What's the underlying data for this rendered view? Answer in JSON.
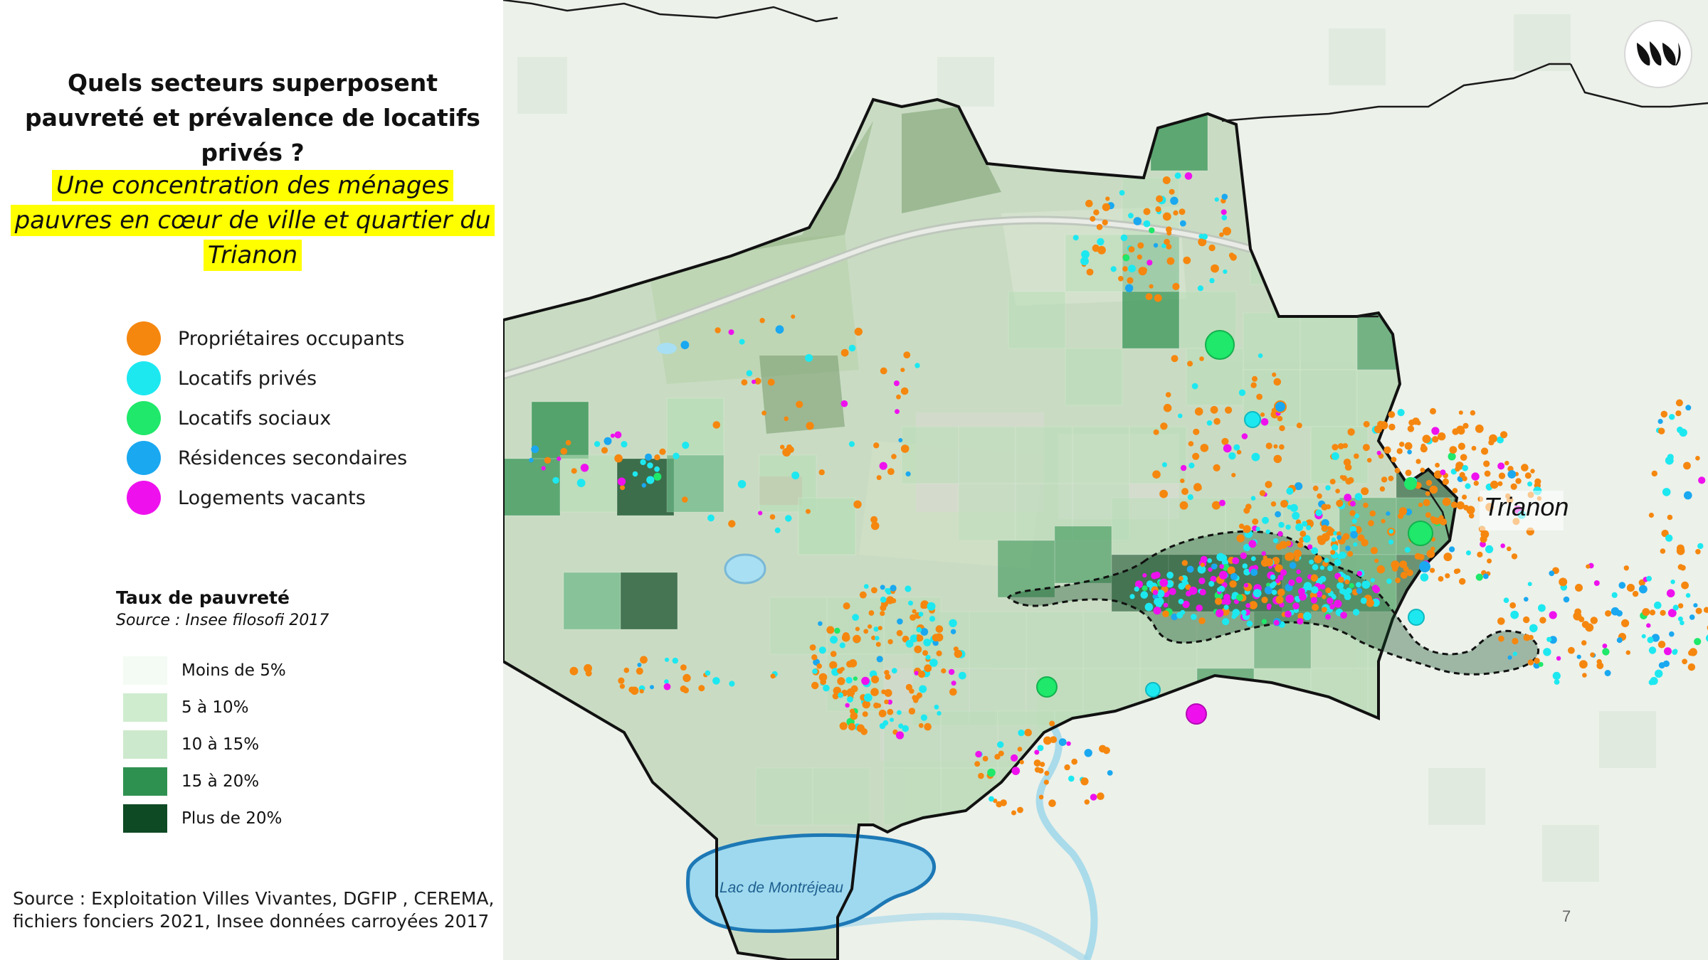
{
  "slide": {
    "title": "Quels secteurs superposent pauvreté et prévalence de locatifs privés ?",
    "subtitle": "Une concentration des ménages pauvres en cœur de ville et quartier du Trianon",
    "page_number": "7"
  },
  "legend": {
    "items": [
      {
        "label": "Propriétaires occupants",
        "color": "#f5870f"
      },
      {
        "label": "Locatifs privés",
        "color": "#1de8f0"
      },
      {
        "label": "Locatifs sociaux",
        "color": "#1fe86a"
      },
      {
        "label": "Résidences secondaires",
        "color": "#1aa8f0"
      },
      {
        "label": "Logements vacants",
        "color": "#ee11ee"
      }
    ]
  },
  "poverty_scale": {
    "title": "Taux de pauvreté",
    "source": "Source : Insee filosofi 2017",
    "classes": [
      {
        "label": "Moins de 5%",
        "color": "#f4fbf4"
      },
      {
        "label": "5 à 10%",
        "color": "#cfeccf"
      },
      {
        "label": "10 à 15%",
        "color": "#cde9cd"
      },
      {
        "label": "15 à 20%",
        "color": "#2f9150"
      },
      {
        "label": "Plus de 20%",
        "color": "#0e4a24"
      }
    ]
  },
  "source_note": {
    "line1": "Source : Exploitation Villes Vivantes, DGFIP , CEREMA,",
    "line2": "fichiers fonciers 2021, Insee données carroyées 2017"
  },
  "map": {
    "labels": {
      "district": "Trianon",
      "lake": "Lac de Montréjeau"
    },
    "logo_icon": "villes-vivantes-logo-icon"
  }
}
